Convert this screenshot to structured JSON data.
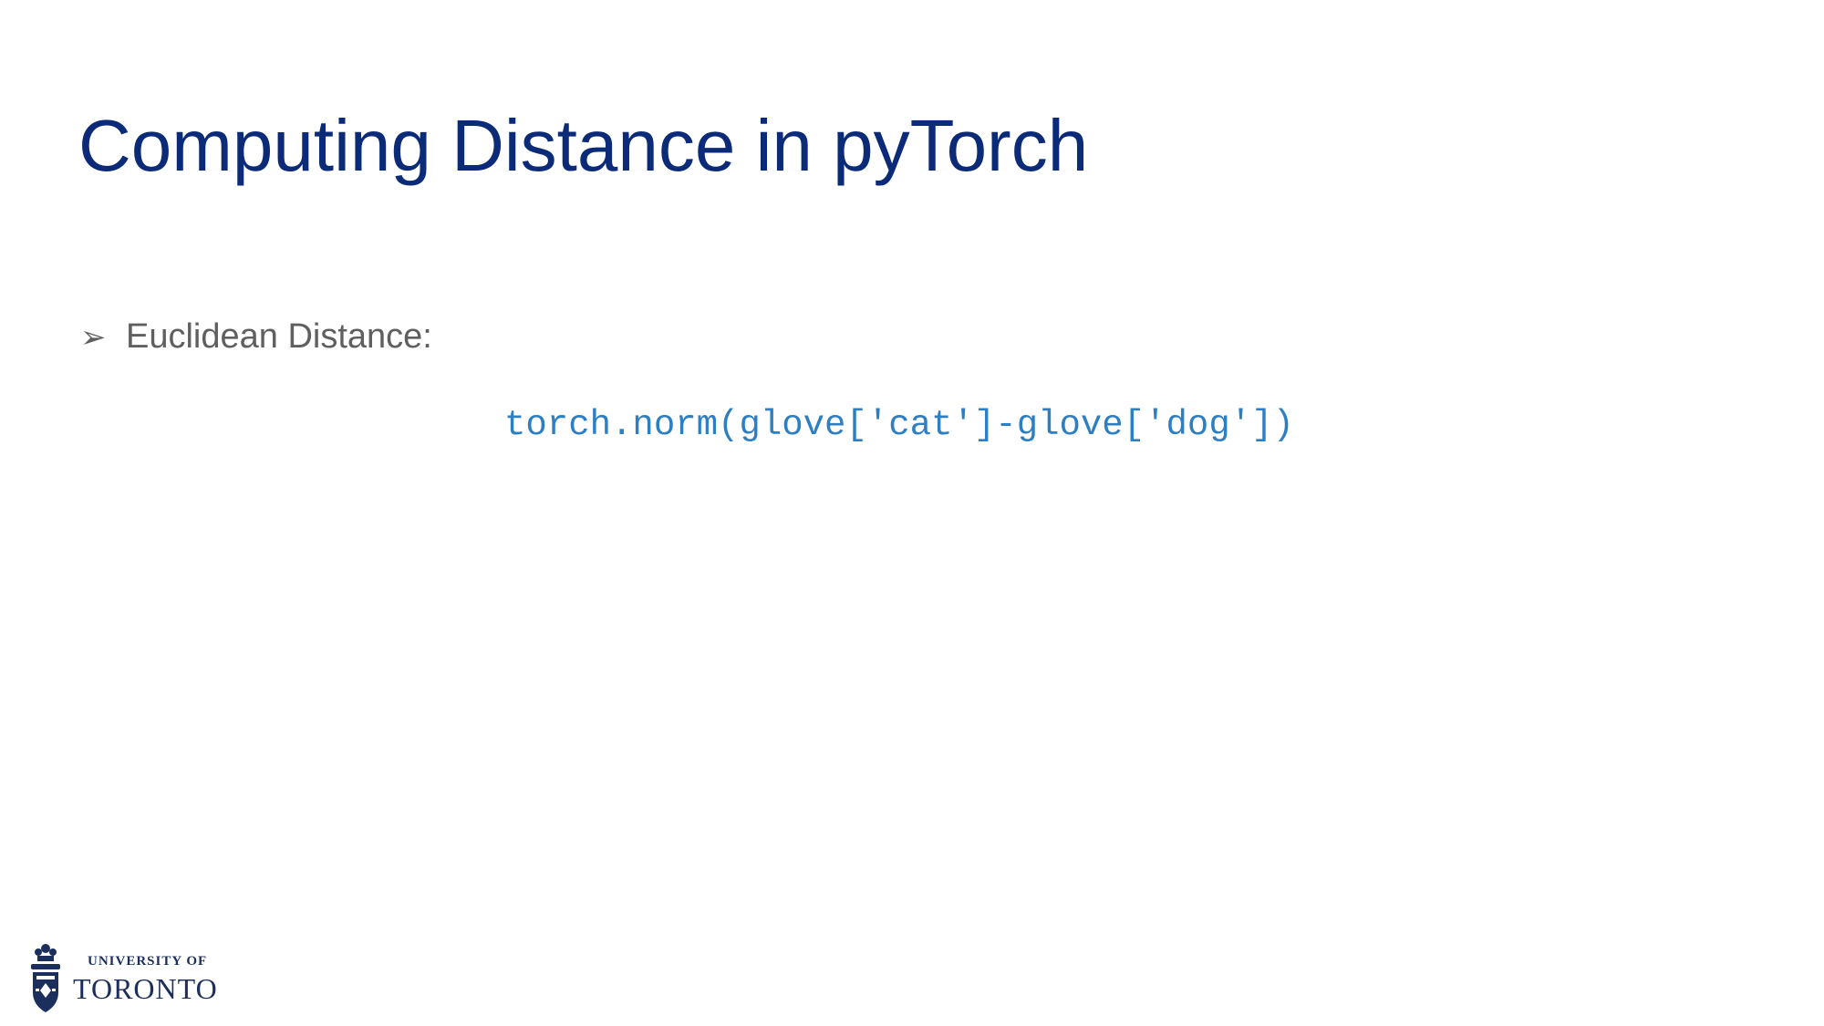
{
  "slide": {
    "title": "Computing Distance in pyTorch",
    "bullets": [
      {
        "marker": "➢",
        "text": "Euclidean Distance:"
      }
    ],
    "code": "torch.norm(glove['cat']-glove['dog'])"
  },
  "logo": {
    "line1": "UNIVERSITY OF",
    "line2": "TORONTO",
    "icon": "university-crest-icon"
  },
  "colors": {
    "title": "#0b2a78",
    "body_text": "#5f5f5f",
    "code": "#2d7fc4",
    "logo": "#1c2f5c"
  }
}
